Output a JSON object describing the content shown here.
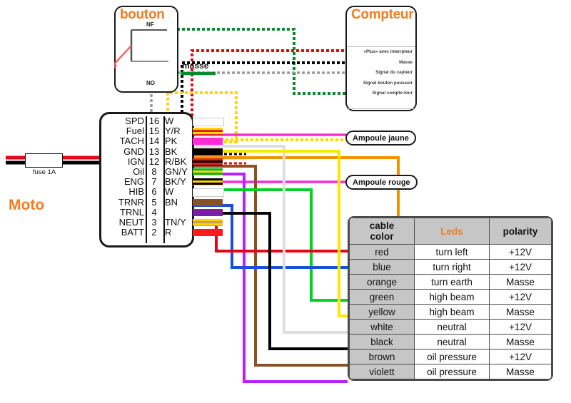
{
  "diagram": {
    "title_moto": "Moto",
    "fuse_label": "fuse 1A"
  },
  "bouton": {
    "title": "bouton",
    "nf_label": "NF",
    "no_label": "NO",
    "masse_label": "masse"
  },
  "compteur": {
    "title": "Compteur",
    "rows": [
      "«Plus» avec interrpteur",
      "Masse",
      "Signal du capteur",
      "Signal bouton poussoir",
      "Signal compte-tour"
    ]
  },
  "lamps": {
    "jaune": "Ampoule jaune",
    "rouge": "Ampoule rouge"
  },
  "connector": {
    "pins": [
      {
        "name": "SPD",
        "num": "16",
        "code": "W",
        "color": "#ffffff",
        "stripe": null
      },
      {
        "name": "Fuel",
        "num": "15",
        "code": "Y/R",
        "color": "#ffd400",
        "stripe": "#e2231a"
      },
      {
        "name": "TACH",
        "num": "14",
        "code": "PK",
        "color": "#ff2bd6",
        "stripe": null
      },
      {
        "name": "GND",
        "num": "13",
        "code": "BK",
        "color": "#000000",
        "stripe": null
      },
      {
        "name": "IGN",
        "num": "12",
        "code": "R/BK",
        "color": "#e2231a",
        "stripe": "#000000"
      },
      {
        "name": "Oil",
        "num": "8",
        "code": "GN/Y",
        "color": "#00b32c",
        "stripe": "#ffd400"
      },
      {
        "name": "ENG",
        "num": "7",
        "code": "BK/Y",
        "color": "#000000",
        "stripe": "#ffd400"
      },
      {
        "name": "HIB",
        "num": "6",
        "code": "W",
        "color": "#ffffff",
        "stripe": null
      },
      {
        "name": "TRNR",
        "num": "5",
        "code": "BN",
        "color": "#8a5122",
        "stripe": null
      },
      {
        "name": "TRNL",
        "num": "4",
        "code": "",
        "color": "#7b1fa2",
        "stripe": null
      },
      {
        "name": "NEUT",
        "num": "3",
        "code": "TN/Y",
        "color": "#ffd400",
        "stripe": "#c8a24a"
      },
      {
        "name": "BATT",
        "num": "2",
        "code": "R",
        "color": "#ff1a1a",
        "stripe": null
      }
    ]
  },
  "legend_table": {
    "headers": [
      "cable color",
      "Leds",
      "polarity"
    ],
    "header_cable_line1": "cable",
    "header_cable_line2": "color",
    "rows": [
      {
        "cable_color": "red",
        "led": "turn left",
        "polarity": "+12V",
        "hex": "#e30613"
      },
      {
        "cable_color": "blue",
        "led": "turn right",
        "polarity": "+12V",
        "hex": "#1a4fd6"
      },
      {
        "cable_color": "orange",
        "led": "turn earth",
        "polarity": "Masse",
        "hex": "#f59000"
      },
      {
        "cable_color": "green",
        "led": "high beam",
        "polarity": "+12V",
        "hex": "#00d423"
      },
      {
        "cable_color": "yellow",
        "led": "high beam",
        "polarity": "Masse",
        "hex": "#ffe600"
      },
      {
        "cable_color": "white",
        "led": "neutral",
        "polarity": "+12V",
        "hex": "#dedede"
      },
      {
        "cable_color": "black",
        "led": "neutral",
        "polarity": "Masse",
        "hex": "#000000"
      },
      {
        "cable_color": "brown",
        "led": "oil pressure",
        "polarity": "+12V",
        "hex": "#8a5122"
      },
      {
        "cable_color": "violett",
        "led": "oil pressure",
        "polarity": "Masse",
        "hex": "#b721ff"
      }
    ]
  },
  "colors": {
    "accent_orange": "#F47B20",
    "magenta": "#ff2bd6",
    "outline": "#1a1a1a"
  }
}
